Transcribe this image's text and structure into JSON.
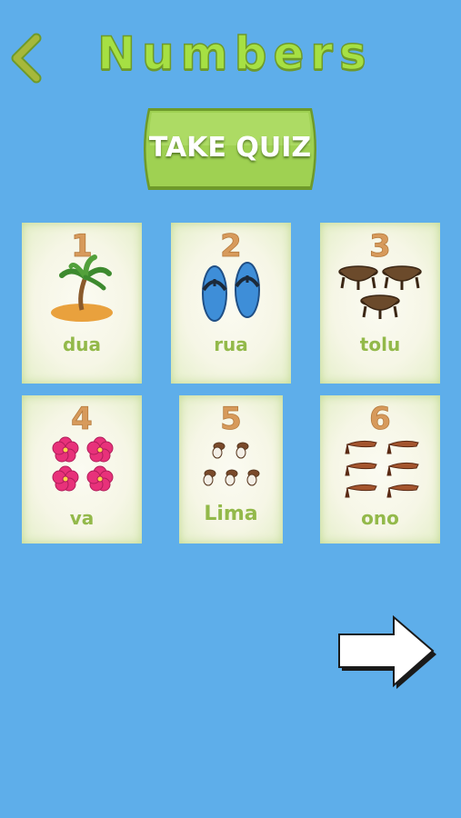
{
  "header": {
    "title": "Numbers",
    "back_icon": "chevron-left-icon"
  },
  "quiz_button": {
    "label": "TAKE QUIZ"
  },
  "cards": [
    {
      "number": "1",
      "word": "dua",
      "icon": "palm-island-icon"
    },
    {
      "number": "2",
      "word": "rua",
      "icon": "flip-flops-icon"
    },
    {
      "number": "3",
      "word": "tolu",
      "icon": "kava-bowls-icon"
    },
    {
      "number": "4",
      "word": "va",
      "icon": "hibiscus-flowers-icon"
    },
    {
      "number": "5",
      "word": "Lima",
      "icon": "shells-icon"
    },
    {
      "number": "6",
      "word": "ono",
      "icon": "fish-icon"
    }
  ],
  "footer": {
    "next_icon": "arrow-right-icon"
  },
  "colors": {
    "background": "#5eaeea",
    "title": "#a6e043",
    "quiz_button": "#9fd152",
    "number": "#d79a5b",
    "word": "#93b94a"
  }
}
